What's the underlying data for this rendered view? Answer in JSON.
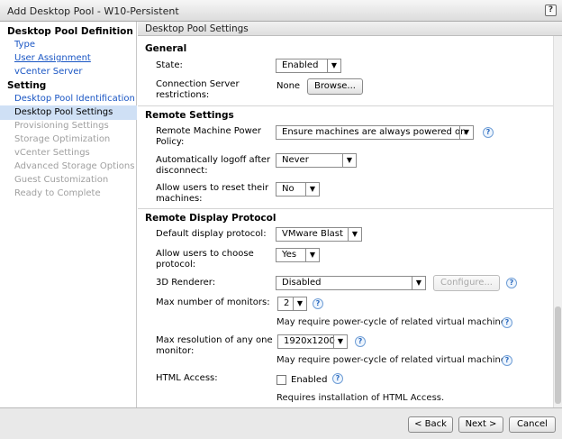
{
  "window": {
    "title": "Add Desktop Pool - W10-Persistent",
    "help_label": "?"
  },
  "sidebar": {
    "groups": [
      {
        "heading": "Desktop Pool Definition",
        "items": [
          {
            "label": "Type"
          },
          {
            "label": "User Assignment"
          },
          {
            "label": "vCenter Server"
          }
        ]
      },
      {
        "heading": "Setting",
        "items": [
          {
            "label": "Desktop Pool Identification"
          },
          {
            "label": "Desktop Pool Settings"
          },
          {
            "label": "Provisioning Settings"
          },
          {
            "label": "Storage Optimization"
          },
          {
            "label": "vCenter Settings"
          },
          {
            "label": "Advanced Storage Options"
          },
          {
            "label": "Guest Customization"
          },
          {
            "label": "Ready to Complete"
          }
        ]
      }
    ]
  },
  "content": {
    "header": "Desktop Pool Settings",
    "general": {
      "title": "General",
      "state_label": "State:",
      "state_value": "Enabled",
      "conn_label_1": "Connection Server",
      "conn_label_2": "restrictions:",
      "conn_value": "None",
      "browse_label": "Browse..."
    },
    "remote_settings": {
      "title": "Remote Settings",
      "power_label_1": "Remote Machine Power",
      "power_label_2": "Policy:",
      "power_value": "Ensure machines are always powered on",
      "logoff_label_1": "Automatically logoff after",
      "logoff_label_2": "disconnect:",
      "logoff_value": "Never",
      "reset_label_1": "Allow users to reset their",
      "reset_label_2": "machines:",
      "reset_value": "No"
    },
    "display": {
      "title": "Remote Display Protocol",
      "default_label": "Default display protocol:",
      "default_value": "VMware Blast",
      "choose_label_1": "Allow users to choose",
      "choose_label_2": "protocol:",
      "choose_value": "Yes",
      "renderer_label": "3D Renderer:",
      "renderer_value": "Disabled",
      "configure_label": "Configure...",
      "monitors_label": "Max number of monitors:",
      "monitors_value": "2",
      "monitors_note": "May require power-cycle of related virtual machines",
      "resolution_label_1": "Max resolution of any one",
      "resolution_label_2": "monitor:",
      "resolution_value": "1920x1200",
      "resolution_note": "May require power-cycle of related virtual machines",
      "html_label": "HTML Access:",
      "html_checkbox_label": "Enabled",
      "html_note": "Requires installation of HTML Access."
    }
  },
  "footer": {
    "back_label": "< Back",
    "next_label": "Next >",
    "cancel_label": "Cancel"
  }
}
